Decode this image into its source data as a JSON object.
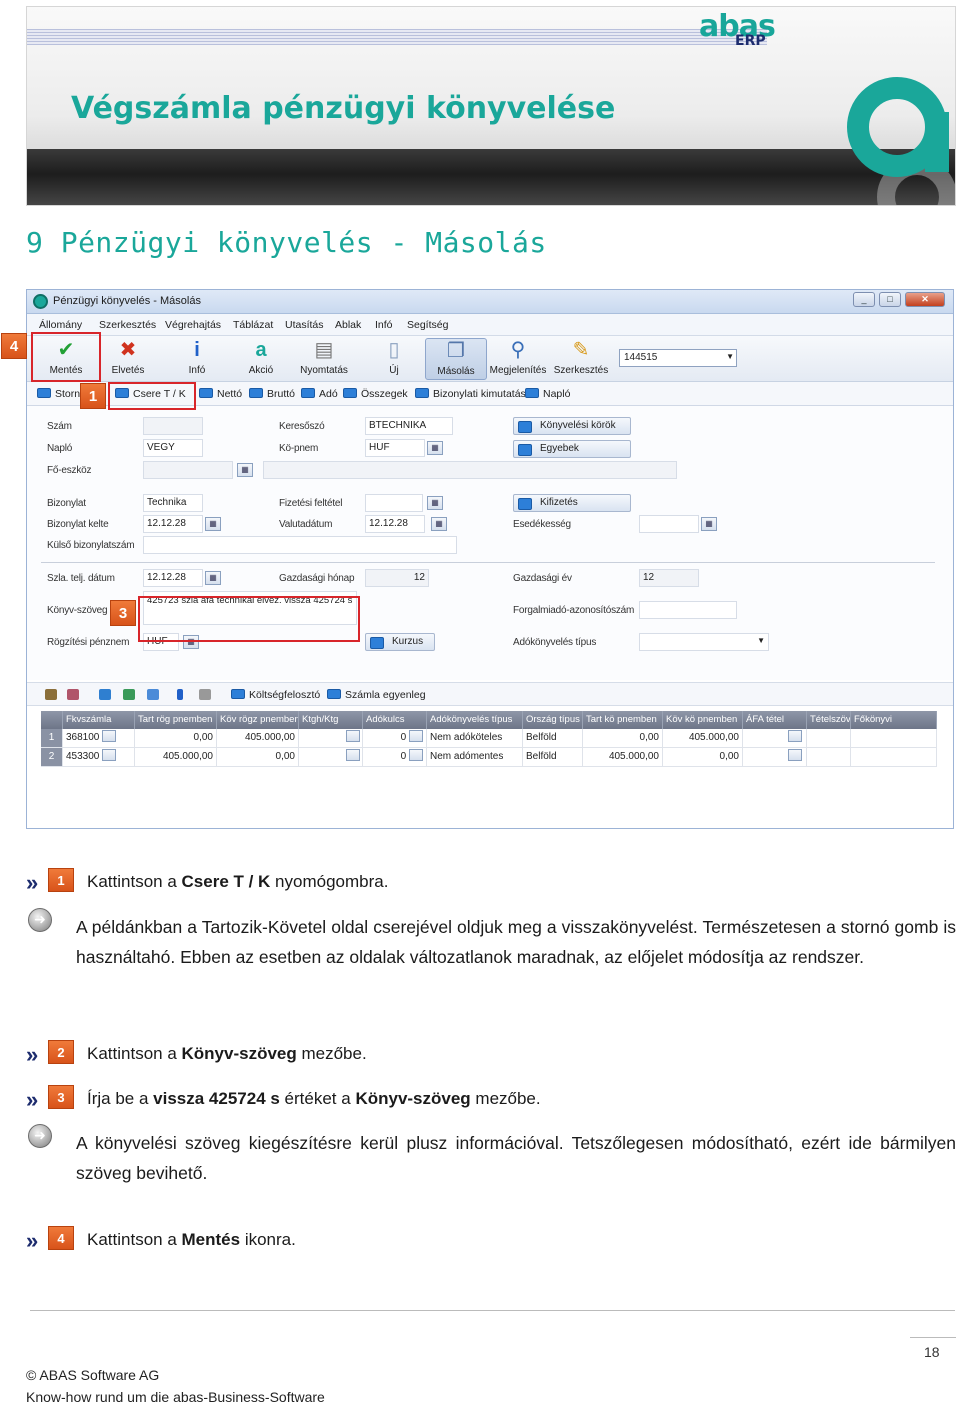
{
  "header": {
    "logo_text": "abas",
    "logo_sub": "ERP",
    "title": "Végszámla pénzügyi könyvelése"
  },
  "section_title": "9 Pénzügyi könyvelés - Másolás",
  "app": {
    "window_title": "Pénzügyi könyvelés - Másolás",
    "window_buttons": [
      "_",
      "□",
      "✕"
    ],
    "menu": [
      "Állomány",
      "Szerkesztés",
      "Végrehajtás",
      "Táblázat",
      "Utasítás",
      "Ablak",
      "Infó",
      "Segítség"
    ],
    "toolbar": [
      "Mentés",
      "Elvetés",
      "Infó",
      "Akció",
      "Nyomtatás",
      "Új",
      "Másolás",
      "Megjelenítés",
      "Szerkesztés"
    ],
    "combo_value": "144515",
    "subbar": [
      "Stornó",
      "Csere T / K",
      "Nettó",
      "Bruttó",
      "Adó",
      "Összegek",
      "Bizonylati kimutatás",
      "Napló"
    ],
    "form": {
      "szam_label": "Szám",
      "naplo_label": "Napló",
      "naplo_value": "VEGY",
      "foeszkoz_label": "Fő-eszköz",
      "kereso_label": "Keresőszó",
      "kereso_value": "BTECHNIKA",
      "kopenz_label": "Kö-pnem",
      "kopenz_value": "HUF",
      "konyvelesi_korok": "Könyvelési körök",
      "egyebek": "Egyebek",
      "bizonylat_label": "Bizonylat",
      "bizonylat_value": "Technika",
      "biz_kelte_label": "Bizonylat kelte",
      "biz_kelte_value": "12.12.28",
      "kulso_label": "Külső bizonylatszám",
      "fizetesi_label": "Fizetési feltétel",
      "valuta_label": "Valutadátum",
      "valuta_value": "12.12.28",
      "kifizetes": "Kifizetés",
      "esedekesseg_label": "Esedékesség",
      "szla_label": "Szla. telj. dátum",
      "szla_value": "12.12.28",
      "gazd_honap_label": "Gazdasági hónap",
      "gazd_honap_value": "12",
      "gazd_ev_label": "Gazdasági év",
      "gazd_ev_value": "12",
      "konyv_szoveg_label": "Könyv-szöveg",
      "konyv_szoveg_value": "425723 szla áfa technikai elvez. vissza 425724 s",
      "forgalmi_label": "Forgalmiadó-azonosítószám",
      "rogzitesi_label": "Rögzítési pénznem",
      "rogzitesi_value": "HUF",
      "kurzus": "Kurzus",
      "adokonyv_label": "Adókönyvelés típus"
    },
    "grid_toolbar": [
      "Költségfelosztó",
      "Számla egyenleg"
    ],
    "grid": {
      "headers": [
        "Fkvszámla",
        "Tart rög pnemben",
        "Köv rögz pnemben",
        "Ktgh/Ktg",
        "Adókulcs",
        "Adókönyvelés típus",
        "Ország típus",
        "Tart kö pnemben",
        "Köv kö pnemben",
        "ÁFA tétel",
        "Tételszöv",
        "Főkönyvi"
      ],
      "rows": [
        {
          "n": "1",
          "fkv": "368100",
          "tart": "0,00",
          "kov": "405.000,00",
          "ado": "0",
          "tipus": "Nem adóköteles",
          "orszag": "Belföld",
          "tartko": "0,00",
          "kovko": "405.000,00"
        },
        {
          "n": "2",
          "fkv": "453300",
          "tart": "405.000,00",
          "kov": "0,00",
          "ado": "0",
          "tipus": "Nem adómentes",
          "orszag": "Belföld",
          "tartko": "405.000,00",
          "kovko": "0,00"
        }
      ]
    },
    "callouts": [
      "4",
      "1",
      "3"
    ]
  },
  "instructions": {
    "step1_num": "1",
    "step1_pre": "Kattintson  a ",
    "step1_bold": "Csere T / K",
    "step1_post": "  nyomógombra.",
    "note1": "A példánkban a Tartozik-Követel oldal cserejével oldjuk meg a visszakönyvelést. Természetesen a stornó gomb is használtahó. Ebben az esetben az oldalak változatlanok maradnak, az előjelet módosítja az rendszer.",
    "step2_num": "2",
    "step2_pre": "Kattintson  a  ",
    "step2_bold": "Könyv-szöveg",
    "step2_post": " mezőbe.",
    "step3_num": "3",
    "step3_pre": "Írja  be  a  ",
    "step3_bold1": "vissza 425724 s",
    "step3_mid": "  értéket  a  ",
    "step3_bold2": "Könyv-szöveg",
    "step3_post": "  mezőbe.",
    "note2": "A könyvelési szöveg kiegészítésre kerül plusz információval. Tetszőlegesen módosítható, ezért ide bármilyen szöveg bevihető.",
    "step4_num": "4",
    "step4_pre": "Kattintson  a ",
    "step4_bold": "Mentés",
    "step4_post": " ikonra."
  },
  "footer": {
    "page_number": "18",
    "copyright": "©  ABAS  Software  AG",
    "tagline": "Know-how  rund  um  die  abas-Business-Software"
  },
  "colors": {
    "accent": "#1aa79a",
    "callout": "#d8252a",
    "badge": "#e0601f"
  }
}
